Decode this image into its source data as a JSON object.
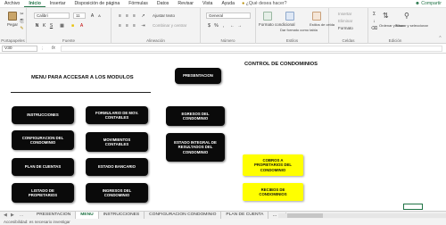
{
  "menubar": {
    "items": [
      "Archivo",
      "Inicio",
      "Insertar",
      "Disposición de página",
      "Fórmulas",
      "Datos",
      "Revisar",
      "Vista",
      "Ayuda"
    ],
    "active_index": 1,
    "tell_me": "¿Qué desea hacer?",
    "share": "Compartir"
  },
  "ribbon": {
    "paste_label": "Pegar",
    "clipboard_label": "Portapapeles",
    "font_name": "Calibri",
    "font_size": "11",
    "font_label": "Fuente",
    "wrap_text": "Ajustar texto",
    "merge_center": "Combinar y centrar",
    "alignment_label": "Alineación",
    "number_format": "General",
    "number_label": "Número",
    "conditional_format": "Formato condicional",
    "format_table": "Dar formato como tabla",
    "cell_styles": "Estilos de celda",
    "styles_label": "Estilos",
    "insert": "Insertar",
    "delete": "Eliminar",
    "format": "Formato",
    "cells_label": "Celdas",
    "sort_filter": "Ordenar y filtrar",
    "find_select": "Buscar y seleccionar",
    "editing_label": "Edición"
  },
  "formula_bar": {
    "name_box": "V30",
    "fx": "fx",
    "content": ""
  },
  "sheet": {
    "title_main": "MENU PARA ACCESAR A LOS MODULOS",
    "title_right": "CONTROL DE CONDOMINIOS",
    "buttons": {
      "presentacion": "PRESENTACION",
      "instrucciones": "INSTRUCCIONES",
      "formulario": "FORMULARIO DE MOV.\nCONTABLES",
      "egresos": "EGRESOS DEL\nCONDOMINIO",
      "configuracion": "CONFIGURACION DEL\nCONDOMINIO",
      "movimientos": "MOVIMIENTOS\nCONTABLES",
      "estado_integral": "ESTADO INTEGRAL DE\nRESULTADOS DEL\nCONDOMINIO",
      "plan_cuentas": "PLAN DE CUENTAS",
      "estado_bancario": "ESTADO BANCARIO",
      "cobros": "COBROS A\nPROPIETARIOS DEL\nCONDOMINIO",
      "listado": "LISTADO DE\nPROPIETARIOS",
      "ingresos": "INGRESOS DEL\nCONDOMINIO",
      "recibos": "RECIBOS DE\nCONDOMINIOS"
    }
  },
  "tabs": {
    "items": [
      "PRESENTACION",
      "MENU",
      "INSTRUCCIONES",
      "CONFIGURACION CONDOMINIO",
      "PLAN DE CUENTA"
    ],
    "active_index": 1,
    "overflow": "...",
    "add": "+"
  },
  "status": {
    "text": "Accesibilidad: es necesario investigar"
  },
  "colors": {
    "accent": "#217346",
    "button_black": "#0a0a0a",
    "button_yellow": "#ffff00"
  }
}
